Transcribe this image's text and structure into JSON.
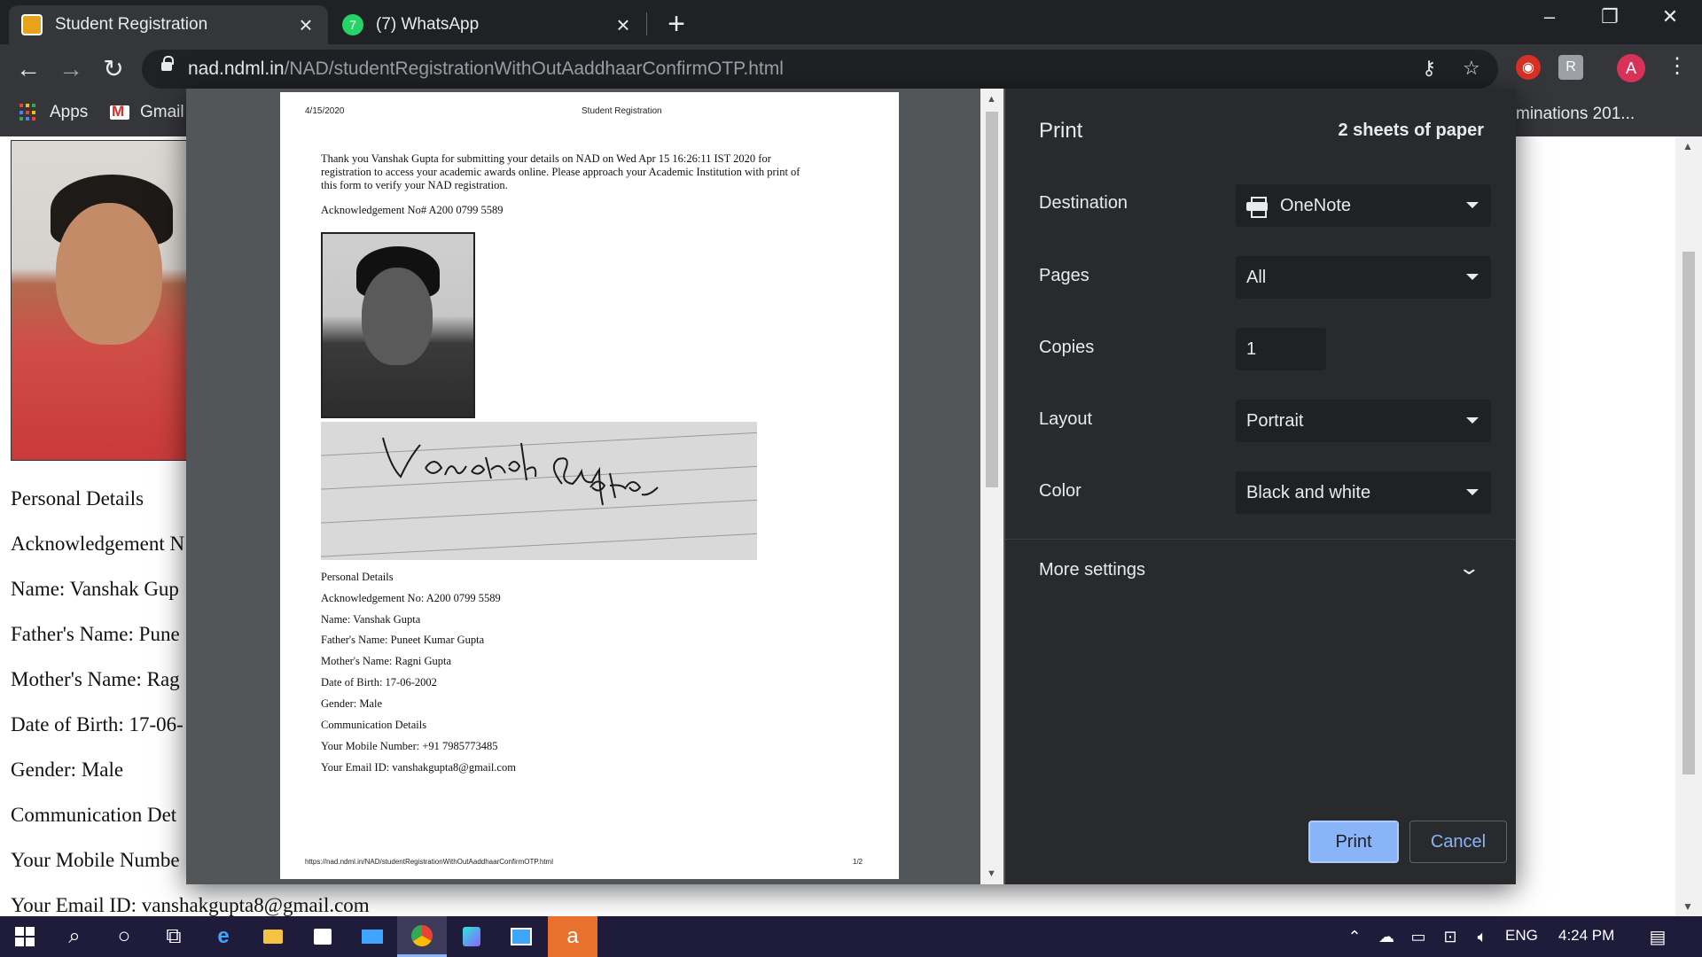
{
  "browser": {
    "tabs": [
      {
        "title": "Student Registration",
        "active": true
      },
      {
        "title": "(7) WhatsApp",
        "active": false
      }
    ],
    "url_host": "nad.ndml.in",
    "url_path": "/NAD/studentRegistrationWithOutAaddhaarConfirmOTP.html",
    "profile_initial": "A",
    "bookmarks": [
      {
        "label": "Apps",
        "icon": "apps-grid-icon"
      },
      {
        "label": "Gmail",
        "icon": "gmail-icon"
      }
    ],
    "bookmark_right": "minations 201..."
  },
  "background_page": {
    "lines": [
      "Personal Details",
      "Acknowledgement N",
      "Name: Vanshak Gup",
      "Father's Name: Pune",
      "Mother's Name: Rag",
      "Date of Birth: 17-06-",
      "Gender: Male",
      "Communication Det",
      "Your Mobile Numbe",
      "Your Email ID: vanshakgupta8@gmail.com"
    ]
  },
  "preview_page": {
    "header_date": "4/15/2020",
    "header_title": "Student Registration",
    "thanks_line1": "Thank you Vanshak Gupta for submitting your details on NAD on  Wed Apr 15 16:26:11 IST 2020 for",
    "thanks_line2": "registration to access your academic awards online. Please approach your Academic Institution with print of",
    "thanks_line3": "this form to verify your NAD registration.",
    "ack_top": "Acknowledgement No# A200 0799 5589",
    "details": [
      "Personal Details",
      "Acknowledgement No: A200 0799 5589",
      "Name: Vanshak Gupta",
      "Father's Name: Puneet Kumar Gupta",
      "Mother's Name: Ragni Gupta",
      "Date of Birth: 17-06-2002",
      "Gender: Male",
      "Communication Details",
      "Your Mobile Number: +91 7985773485",
      "Your Email ID: vanshakgupta8@gmail.com"
    ],
    "footer_url": "https://nad.ndml.in/NAD/studentRegistrationWithOutAaddhaarConfirmOTP.html",
    "footer_page": "1/2"
  },
  "print_settings": {
    "title": "Print",
    "sheets": "2 sheets of paper",
    "destination_label": "Destination",
    "destination_value": "OneNote",
    "pages_label": "Pages",
    "pages_value": "All",
    "copies_label": "Copies",
    "copies_value": "1",
    "layout_label": "Layout",
    "layout_value": "Portrait",
    "color_label": "Color",
    "color_value": "Black and white",
    "more_settings": "More settings",
    "print_button": "Print",
    "cancel_button": "Cancel"
  },
  "taskbar": {
    "language": "ENG",
    "time": "4:24 PM"
  },
  "colors": {
    "chrome_dark": "#202124",
    "chrome_toolbar": "#35363a",
    "dialog_settings_bg": "#292a2d",
    "accent_blue": "#8ab4f8",
    "taskbar_bg": "#1f1b3a"
  }
}
